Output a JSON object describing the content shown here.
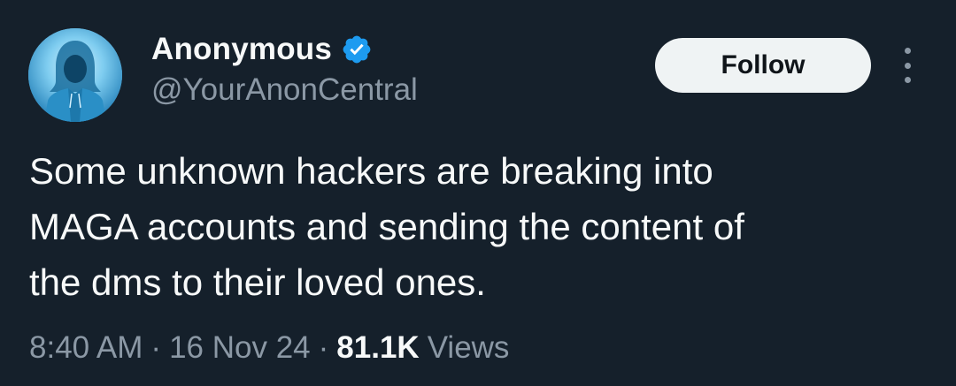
{
  "author": {
    "display_name": "Anonymous",
    "handle": "@YourAnonCentral",
    "verified": true,
    "verified_color": "#1d9bf0",
    "avatar": "hooded-figure-avatar"
  },
  "actions": {
    "follow_label": "Follow",
    "more_icon": "more-vertical-icon"
  },
  "tweet": {
    "text": "Some unknown hackers are breaking into\nMAGA accounts and sending the content of\nthe dms to their loved ones.",
    "time": "8:40 AM",
    "date": "16 Nov 24",
    "separator": "·",
    "views_count": "81.1K",
    "views_label": "Views"
  },
  "colors": {
    "background": "#15202b",
    "primary_text": "#f7f9f9",
    "secondary_text": "#8b98a5",
    "button_bg": "#eff3f4"
  }
}
